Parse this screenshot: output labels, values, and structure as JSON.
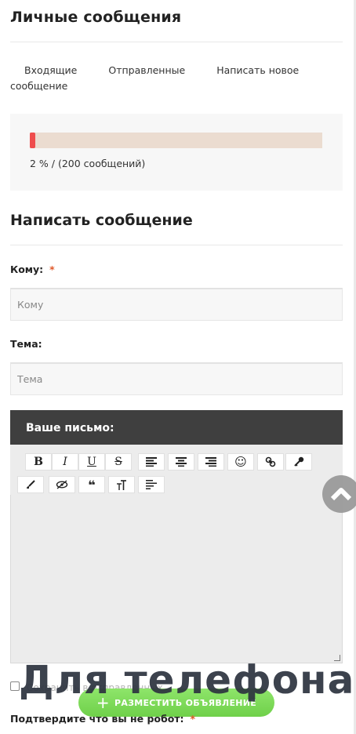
{
  "page": {
    "title": "Личные сообщения"
  },
  "tabs": {
    "inbox": "Входящие",
    "sent": "Отправленные",
    "compose": "Написать новое сообщение"
  },
  "quota": {
    "percent": 2,
    "text": "2 % / (200 сообщений)",
    "fill_color": "#ef4d4d",
    "track_color": "#ebdcd0"
  },
  "compose": {
    "title": "Написать сообщение",
    "to_label": "Кому:",
    "required_mark": "*",
    "to_placeholder": "Кому",
    "subject_label": "Тема:",
    "subject_placeholder": "Тема",
    "editor_title": "Ваше письмо:"
  },
  "toolbar": {
    "bold": "B",
    "italic": "I",
    "underline": "U",
    "strike": "S",
    "emoji": "☺",
    "quote": "❝"
  },
  "footer": {
    "checkbox_text": "Сохранить в отправленных",
    "post_ad_label": "РАЗМЕСТИТЬ ОБЪЯВЛЕНИЕ",
    "captcha_label": "Подтвердите что вы не робот:",
    "overlay_caption": "Для телефона"
  },
  "icons": {
    "scroll_top": "chevron-up-icon"
  }
}
